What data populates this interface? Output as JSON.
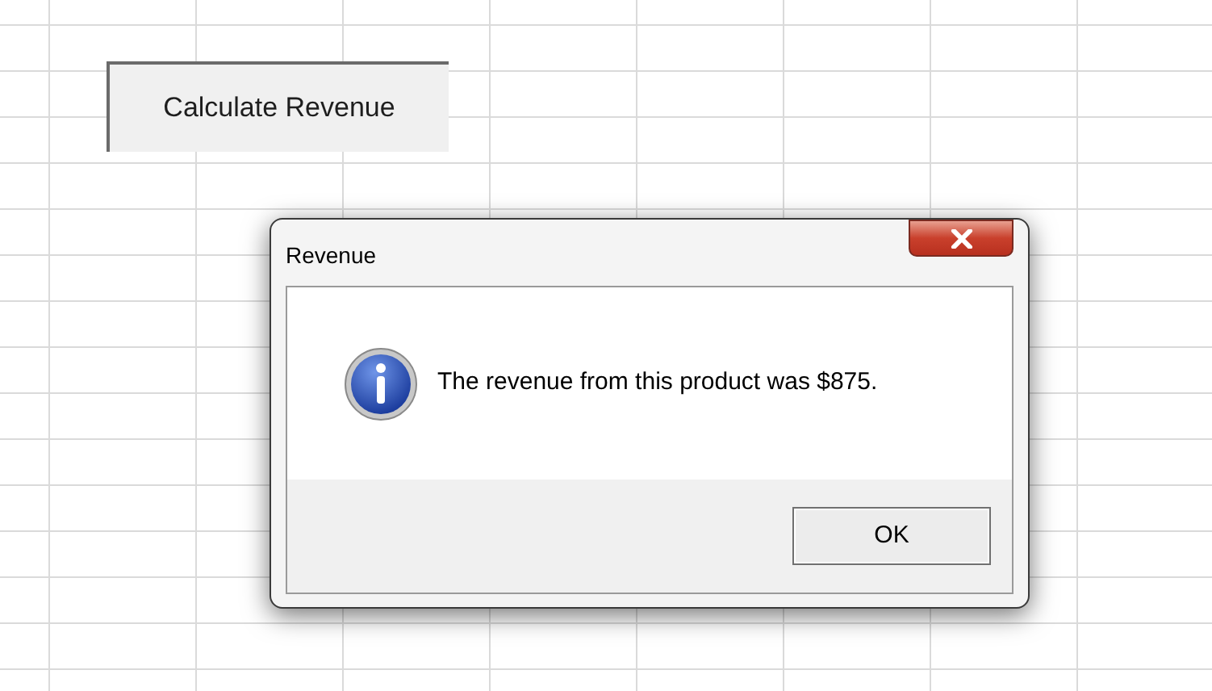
{
  "sheet_button": {
    "label": "Calculate Revenue"
  },
  "dialog": {
    "title": "Revenue",
    "message": "The revenue from this product was $875.",
    "buttons": [
      {
        "label": "OK"
      }
    ]
  }
}
